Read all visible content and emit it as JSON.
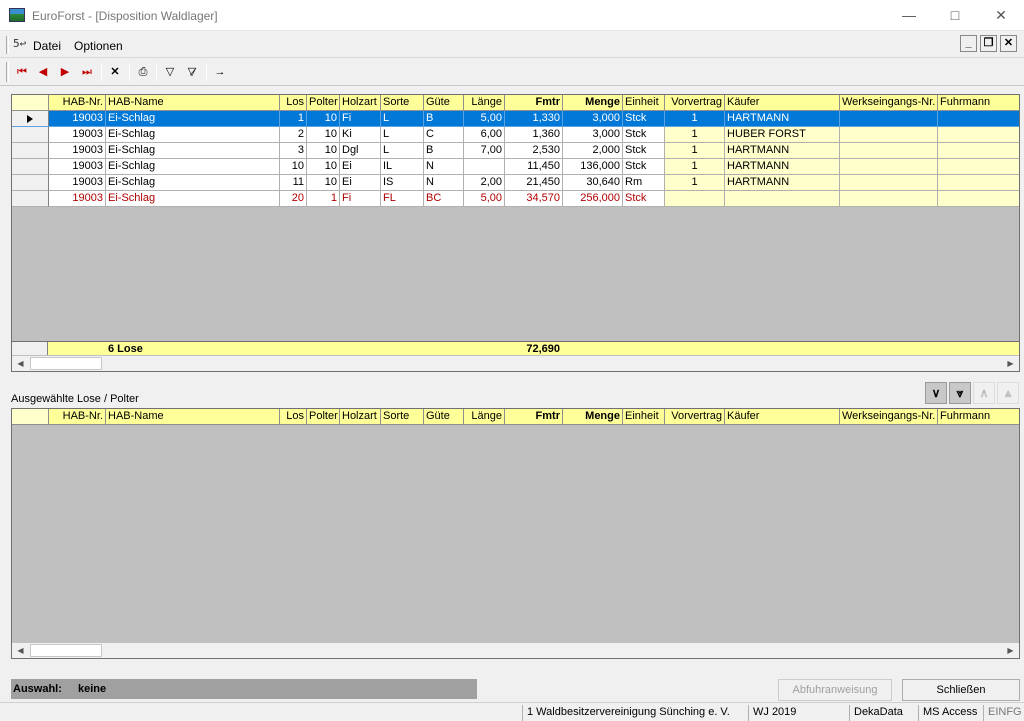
{
  "window": {
    "title": "EuroForst - [Disposition Waldlager]",
    "minimize_icon": "minimize-icon",
    "maximize_icon": "maximize-icon",
    "close_icon": "close-icon"
  },
  "menubar": {
    "items": [
      "Datei",
      "Optionen"
    ]
  },
  "toolbar": {
    "icons": [
      "first-record-icon",
      "prev-record-icon",
      "next-record-icon",
      "last-record-icon",
      "delete-icon",
      "print-icon",
      "filter-icon",
      "clear-filter-icon",
      "exit-icon"
    ]
  },
  "columns": [
    "HAB-Nr.",
    "HAB-Name",
    "Los",
    "Polter",
    "Holzart",
    "Sorte",
    "Güte",
    "Länge",
    "Fmtr",
    "Menge",
    "Einheit",
    "Vorvertrag",
    "Käufer",
    "Werkseingangs-Nr.",
    "Fuhrmann"
  ],
  "rows": [
    {
      "hab_nr": "19003",
      "hab_name": "Ei-Schlag",
      "los": "1",
      "polter": "10",
      "holzart": "Fi",
      "sorte": "L",
      "guete": "B",
      "laenge": "5,00",
      "fmtr": "1,330",
      "menge": "3,000",
      "einheit": "Stck",
      "vorvertrag": "1",
      "kaeufer": "HARTMANN",
      "werkseingang": "",
      "fuhrmann": ""
    },
    {
      "hab_nr": "19003",
      "hab_name": "Ei-Schlag",
      "los": "2",
      "polter": "10",
      "holzart": "Ki",
      "sorte": "L",
      "guete": "C",
      "laenge": "6,00",
      "fmtr": "1,360",
      "menge": "3,000",
      "einheit": "Stck",
      "vorvertrag": "1",
      "kaeufer": "HUBER FORST",
      "werkseingang": "",
      "fuhrmann": ""
    },
    {
      "hab_nr": "19003",
      "hab_name": "Ei-Schlag",
      "los": "3",
      "polter": "10",
      "holzart": "Dgl",
      "sorte": "L",
      "guete": "B",
      "laenge": "7,00",
      "fmtr": "2,530",
      "menge": "2,000",
      "einheit": "Stck",
      "vorvertrag": "1",
      "kaeufer": "HARTMANN",
      "werkseingang": "",
      "fuhrmann": ""
    },
    {
      "hab_nr": "19003",
      "hab_name": "Ei-Schlag",
      "los": "10",
      "polter": "10",
      "holzart": "Ei",
      "sorte": "IL",
      "guete": "N",
      "laenge": "",
      "fmtr": "11,450",
      "menge": "136,000",
      "einheit": "Stck",
      "vorvertrag": "1",
      "kaeufer": "HARTMANN",
      "werkseingang": "",
      "fuhrmann": ""
    },
    {
      "hab_nr": "19003",
      "hab_name": "Ei-Schlag",
      "los": "11",
      "polter": "10",
      "holzart": "Ei",
      "sorte": "IS",
      "guete": "N",
      "laenge": "2,00",
      "fmtr": "21,450",
      "menge": "30,640",
      "einheit": "Rm",
      "vorvertrag": "1",
      "kaeufer": "HARTMANN",
      "werkseingang": "",
      "fuhrmann": ""
    },
    {
      "hab_nr": "19003",
      "hab_name": "Ei-Schlag",
      "los": "20",
      "polter": "1",
      "holzart": "Fi",
      "sorte": "FL",
      "guete": "BC",
      "laenge": "5,00",
      "fmtr": "34,570",
      "menge": "256,000",
      "einheit": "Stck",
      "vorvertrag": "",
      "kaeufer": "",
      "werkseingang": "",
      "fuhrmann": ""
    }
  ],
  "summary": {
    "count": "6 Lose",
    "fmtr_total": "72,690"
  },
  "section_label": "Ausgewählte Lose / Polter",
  "nav_icons": [
    "move-down-icon",
    "move-all-down-icon",
    "move-up-icon",
    "move-all-up-icon"
  ],
  "auswahl": {
    "label": "Auswahl:",
    "value": "keine"
  },
  "buttons": {
    "abfuhr": "Abfuhranweisung",
    "close": "Schließen"
  },
  "status": [
    "1 Waldbesitzervereinigung Sünching e. V.",
    "WJ 2019",
    "DekaData",
    "MS Access",
    "EINFG"
  ]
}
